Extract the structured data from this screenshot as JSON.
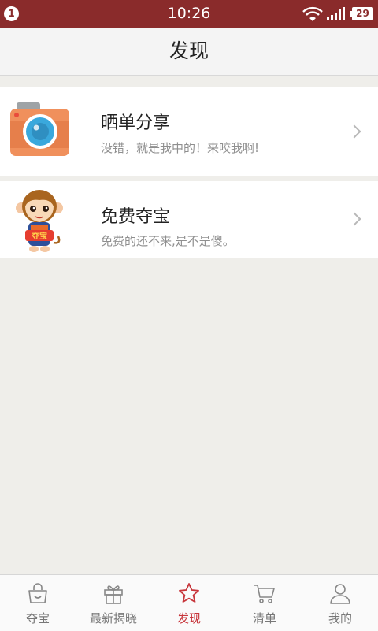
{
  "statusbar": {
    "notification_count": "1",
    "time": "10:26",
    "battery": "29"
  },
  "header": {
    "title": "发现"
  },
  "items": [
    {
      "icon": "camera-icon",
      "title": "晒单分享",
      "subtitle": "没错，就是我中的！来咬我啊!"
    },
    {
      "icon": "monkey-mascot-icon",
      "title": "免费夺宝",
      "subtitle": "免费的还不来,是不是傻。",
      "mascot_text": "夺宝"
    }
  ],
  "tabbar": {
    "active_color": "#c7353b",
    "tabs": [
      {
        "icon": "bag-icon",
        "label": "夺宝",
        "active": false
      },
      {
        "icon": "gift-icon",
        "label": "最新揭晓",
        "active": false
      },
      {
        "icon": "star-icon",
        "label": "发现",
        "active": true
      },
      {
        "icon": "cart-icon",
        "label": "清单",
        "active": false
      },
      {
        "icon": "user-icon",
        "label": "我的",
        "active": false
      }
    ]
  },
  "colors": {
    "statusbar_bg": "#8a2b2b",
    "page_bg": "#efeeea",
    "camera_orange": "#f0905c",
    "camera_lens": "#3aa8dc"
  }
}
